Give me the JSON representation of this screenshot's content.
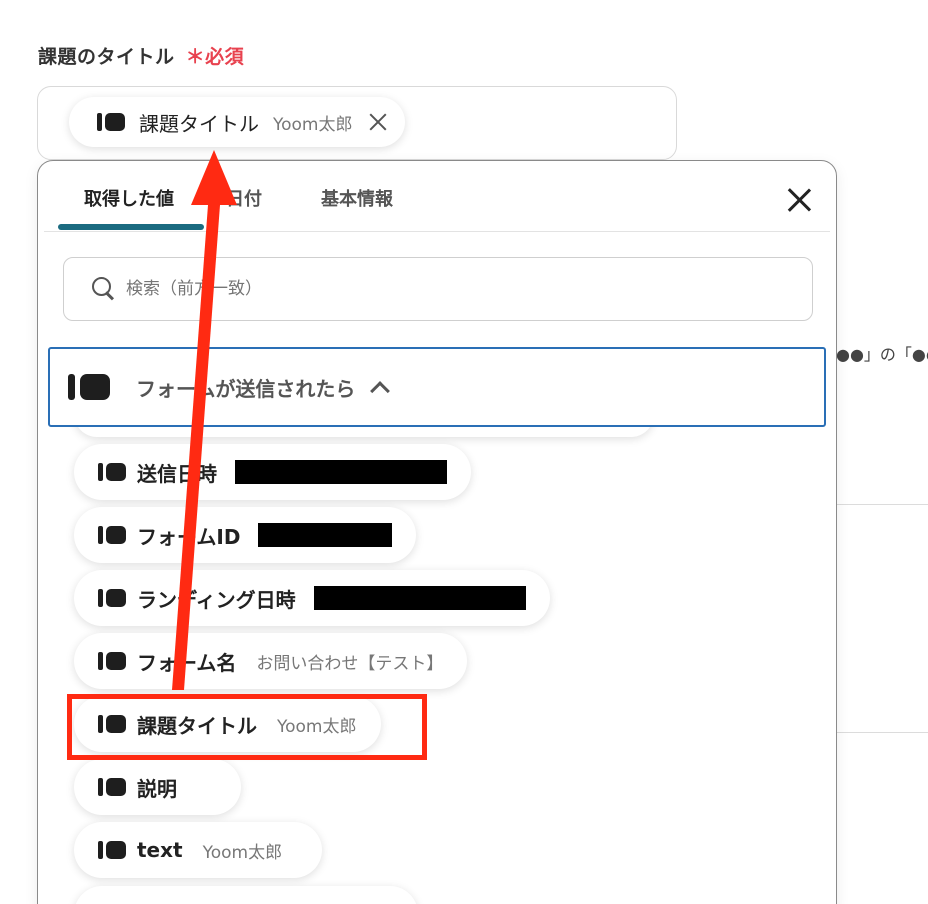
{
  "field": {
    "label": "課題のタイトル",
    "required_mark": "＊",
    "required_text": "必須"
  },
  "selected_chip": {
    "label": "課題タイトル",
    "value": "Yoom太郎"
  },
  "background": {
    "snippet": "●●」の「●●"
  },
  "popup": {
    "tabs": [
      {
        "label": "取得した値",
        "active": true
      },
      {
        "label": "日付",
        "active": false
      },
      {
        "label": "基本情報",
        "active": false
      }
    ],
    "search": {
      "placeholder": "検索（前方一致）"
    },
    "section": {
      "title": "フォームが送信されたら"
    },
    "items": [
      {
        "label": "送信日時",
        "value": "",
        "redacted": true
      },
      {
        "label": "フォームID",
        "value": "",
        "redacted": true
      },
      {
        "label": "ランディング日時",
        "value": "",
        "redacted": true
      },
      {
        "label": "フォーム名",
        "value": "お問い合わせ【テスト】"
      },
      {
        "label": "課題タイトル",
        "value": "Yoom太郎",
        "highlighted": true
      },
      {
        "label": "説明",
        "value": ""
      },
      {
        "label": "text",
        "value": "Yoom太郎"
      }
    ]
  },
  "colors": {
    "required": "#e8424f",
    "tab_underline": "#1b6b80",
    "section_border": "#2a6fb6",
    "annotation": "#ff2a12"
  },
  "icons": [
    "tag-icon",
    "close-icon",
    "search-icon",
    "chevron-up-icon"
  ]
}
